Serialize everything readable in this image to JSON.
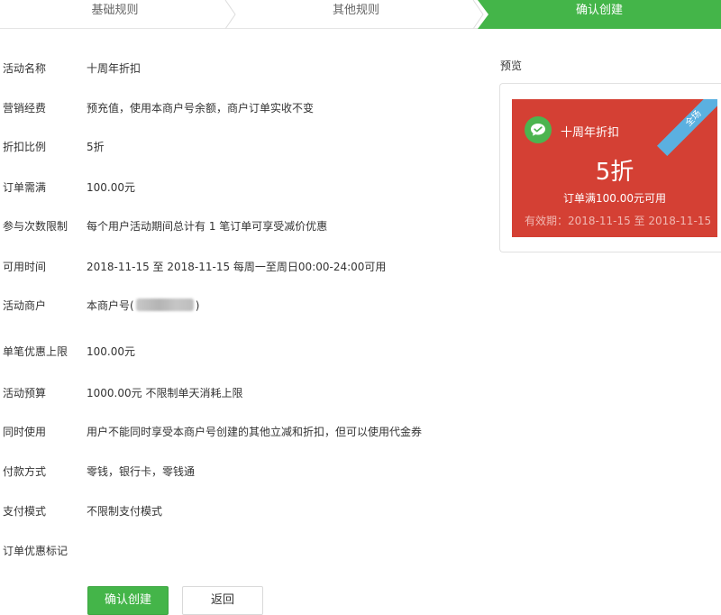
{
  "steps": [
    "基础规则",
    "其他规则",
    "确认创建"
  ],
  "details": [
    {
      "label": "活动名称",
      "value": "十周年折扣"
    },
    {
      "label": "营销经费",
      "value": "预充值，使用本商户号余额，商户订单实收不变"
    },
    {
      "label": "折扣比例",
      "value": "5折"
    },
    {
      "label": "订单需满",
      "value": "100.00元"
    },
    {
      "label": "参与次数限制",
      "value": "每个用户活动期间总计有 1 笔订单可享受减价优惠"
    },
    {
      "label": "可用时间",
      "value": "2018-11-15 至 2018-11-15 每周一至周日00:00-24:00可用"
    },
    {
      "label": "活动商户",
      "value_prefix": "本商户号(",
      "value_suffix": ")"
    },
    {
      "label": "单笔优惠上限",
      "value": "100.00元"
    },
    {
      "label": "活动预算",
      "value": "1000.00元 不限制单天消耗上限"
    },
    {
      "label": "同时使用",
      "value": "用户不能同时享受本商户号创建的其他立减和折扣，但可以使用代金券"
    },
    {
      "label": "付款方式",
      "value": "零钱，银行卡，零钱通"
    },
    {
      "label": "支付模式",
      "value": "不限制支付模式"
    },
    {
      "label": "订单优惠标记",
      "value": ""
    }
  ],
  "buttons": {
    "confirm": "确认创建",
    "back": "返回"
  },
  "preview": {
    "label": "预览",
    "ribbon": "全场",
    "name": "十周年折扣",
    "discount": "5折",
    "condition": "订单满100.00元可用",
    "validity": "有效期：2018-11-15 至 2018-11-15"
  },
  "colors": {
    "accent_green": "#44b549",
    "card_red": "#d44034",
    "ribbon_blue": "#5bb0e0",
    "logo_green": "#4cb44f"
  }
}
